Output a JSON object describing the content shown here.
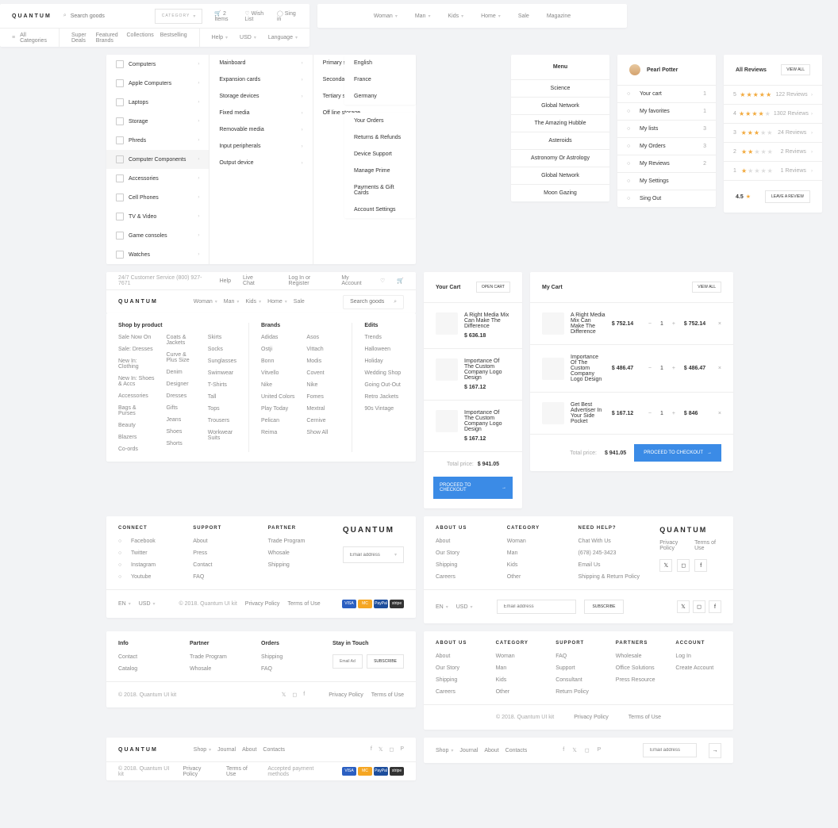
{
  "header1": {
    "logo": "QUANTUM",
    "search_ph": "Search goods",
    "category": "CATEGORY",
    "cart": "2 Items",
    "wishlist": "Wish List",
    "signin": "Sing in",
    "allcat": "All Categories",
    "nav": [
      "Super Deals",
      "Featured Brands",
      "Collections",
      "Bestselling"
    ],
    "help": "Help",
    "usd": "USD",
    "lang": "Language"
  },
  "simpleNav": [
    "Woman",
    "Man",
    "Kids",
    "Home",
    "Sale",
    "Magazine"
  ],
  "mega": {
    "col1": [
      "Computers",
      "Apple Computers",
      "Laptops",
      "Storage",
      "Phreds",
      "Computer Components",
      "Accessories",
      "Cell Phones",
      "TV & Video",
      "Game consoles",
      "Watches"
    ],
    "col1_active": 5,
    "col2": [
      "Mainboard",
      "Expansion cards",
      "Storage devices",
      "Fixed media",
      "Removable media",
      "Input peripherals",
      "Output device"
    ],
    "col3": [
      "Primary storage",
      "Secondary storage",
      "Tertiary storage",
      "Off line storage"
    ]
  },
  "countries": [
    "English",
    "France",
    "Germany"
  ],
  "account": [
    "Your Orders",
    "Returns & Refunds",
    "Device Support",
    "Manage Prime",
    "Payments & Gift Cards",
    "Account Settings"
  ],
  "topics": {
    "title": "Menu",
    "items": [
      "Science",
      "Global Network",
      "The Amazing Hubble",
      "Asteroids",
      "Astronomy Or Astrology",
      "Global Network",
      "Moon Gazing"
    ]
  },
  "user": {
    "name": "Pearl Potter",
    "menu": [
      {
        "l": "Your cart",
        "n": "1"
      },
      {
        "l": "My favorites",
        "n": "1"
      },
      {
        "l": "My lists",
        "n": "3"
      },
      {
        "l": "My Orders",
        "n": "3"
      },
      {
        "l": "My Reviews",
        "n": "2"
      },
      {
        "l": "My Settings",
        "n": ""
      },
      {
        "l": "Sing Out",
        "n": ""
      }
    ]
  },
  "reviews": {
    "title": "All Reviews",
    "view": "VIEW ALL",
    "rows": [
      {
        "r": "5",
        "s": 5,
        "t": "122 Reviews"
      },
      {
        "r": "4",
        "s": 4,
        "t": "1302 Reviews"
      },
      {
        "r": "3",
        "s": 3,
        "t": "24 Reviews"
      },
      {
        "r": "2",
        "s": 2,
        "t": "2 Reviews"
      },
      {
        "r": "1",
        "s": 1,
        "t": "1 Reviews"
      }
    ],
    "avg": "4.5",
    "leave": "LEAVE A REVIEW"
  },
  "header2": {
    "service": "24/7 Customer Service (800) 927-7671",
    "help": "Help",
    "chat": "Live Chat",
    "login": "Log In or Register",
    "account": "My Account",
    "logo": "QUANTUM",
    "nav": [
      "Woman",
      "Man",
      "Kids",
      "Home",
      "Sale"
    ],
    "search_ph": "Search goods"
  },
  "shopnav": {
    "title": "Shop by product",
    "brands": "Brands",
    "edits": "Edits",
    "c1": [
      "Sale Now On",
      "Sale: Dresses",
      "New In: Clothing",
      "New In: Shoes & Accs",
      "Accessories",
      "Bags & Purses",
      "Beauty",
      "Blazers",
      "Co-ords"
    ],
    "c2": [
      "Coats & Jackets",
      "Curve & Plus Size",
      "Denim",
      "Designer",
      "Dresses",
      "Gifts",
      "Jeans",
      "Shoes",
      "Shorts"
    ],
    "c3": [
      "Skirts",
      "Socks",
      "Sunglasses",
      "Swimwear",
      "T-Shirts",
      "Tall",
      "Tops",
      "Trousers",
      "Workwear Suits"
    ],
    "c4": [
      "Adidas",
      "Ostji",
      "Bonn",
      "Vitvello",
      "Nike",
      "United Colors",
      "Play Today",
      "Pelican",
      "Reima"
    ],
    "c5": [
      "Asos",
      "Vittach",
      "Modis",
      "Covent",
      "Nike",
      "Fomes",
      "Mextral",
      "Cernive",
      "Show All"
    ],
    "c6": [
      "Trends",
      "Halloween",
      "Holiday",
      "Wedding Shop",
      "Going Out-Out",
      "Retro Jackets",
      "90s Vintage"
    ]
  },
  "cart1": {
    "title": "Your Cart",
    "open": "OPEN CART",
    "items": [
      {
        "n": "A Right Media Mix Can Make The Difference",
        "p": "$ 636.18"
      },
      {
        "n": "Importance Of The Custom Company Logo Design",
        "p": "$ 167.12"
      },
      {
        "n": "Importance Of The Custom Company Logo Design",
        "p": "$ 167.12"
      }
    ],
    "total_l": "Total price:",
    "total": "$ 941.05",
    "checkout": "PROCEED TO CHECKOUT"
  },
  "cart2": {
    "title": "My Cart",
    "view": "VIEW ALL",
    "items": [
      {
        "n": "A Right Media Mix Can Make The Difference",
        "p": "$ 752.14",
        "q": "1",
        "t": "$ 752.14"
      },
      {
        "n": "Importance Of The Custom Company Logo Design",
        "p": "$ 486.47",
        "q": "1",
        "t": "$ 486.47"
      },
      {
        "n": "Get Best Advertiser In Your Side Pocket",
        "p": "$ 167.12",
        "q": "1",
        "t": "$ 846"
      }
    ],
    "total_l": "Total price:",
    "total": "$ 941.05",
    "checkout": "PROCEED TO CHECKOUT"
  },
  "footer1": {
    "connect": "CONNECT",
    "support": "SUPPORT",
    "partner": "PARTNER",
    "social": [
      "Facebook",
      "Twitter",
      "Instagram",
      "Youtube"
    ],
    "sup": [
      "About",
      "Press",
      "Contact",
      "FAQ"
    ],
    "par": [
      "Trade Program",
      "Whosale",
      "Shipping"
    ],
    "email_ph": "Email address",
    "en": "EN",
    "usd": "USD",
    "copy": "© 2018. Quantum UI kit",
    "priv": "Privacy Policy",
    "terms": "Terms of Use",
    "logo": "QUANTUM"
  },
  "footer2": {
    "about": "ABOUT US",
    "cat": "CATEGORY",
    "need": "NEED HELP?",
    "a": [
      "About",
      "Our Story",
      "Shipping",
      "Careers"
    ],
    "c": [
      "Woman",
      "Man",
      "Kids",
      "Other"
    ],
    "h": [
      "Chat With Us",
      "(678) 245-3423",
      "Email Us",
      "Shipping & Return Policy"
    ],
    "logo": "QUANTUM",
    "priv": "Privacy Policy",
    "terms": "Terms of Use",
    "en": "EN",
    "usd": "USD",
    "email_ph": "Email address",
    "sub": "SUBSCRIBE"
  },
  "footer3": {
    "info": "Info",
    "partner": "Partner",
    "orders": "Orders",
    "stay": "Stay in Touch",
    "i": [
      "Contact",
      "Catalog"
    ],
    "p": [
      "Trade Program",
      "Whosale"
    ],
    "o": [
      "Shipping",
      "FAQ"
    ],
    "email_ph": "Email Address",
    "sub": "SUBSCRIBE",
    "copy": "© 2018. Quantum UI kit",
    "priv": "Privacy Policy",
    "terms": "Terms of Use"
  },
  "footer4": {
    "logo": "QUANTUM",
    "nav": [
      "Shop",
      "Journal",
      "About",
      "Contacts"
    ],
    "copy": "© 2018. Quantum UI kit",
    "priv": "Privacy Policy",
    "terms": "Terms of Use",
    "accept": "Accepted payment methods"
  },
  "footer5": {
    "about": "ABOUT US",
    "cat": "CATEGORY",
    "support": "SUPPORT",
    "partners": "PARTNERS",
    "account": "ACCOUNT",
    "a": [
      "About",
      "Our Story",
      "Shipping",
      "Careers"
    ],
    "c": [
      "Woman",
      "Man",
      "Kids",
      "Other"
    ],
    "s": [
      "FAQ",
      "Support",
      "Consultant",
      "Return Policy"
    ],
    "p": [
      "Wholesale",
      "Office Solutions",
      "Press Resource"
    ],
    "ac": [
      "Log In",
      "Create Account"
    ],
    "copy": "© 2018. Quantum UI kit",
    "priv": "Privacy Policy",
    "terms": "Terms of Use"
  },
  "footer6": {
    "nav": [
      "Shop",
      "Journal",
      "About",
      "Contacts"
    ],
    "email_ph": "Email address"
  }
}
